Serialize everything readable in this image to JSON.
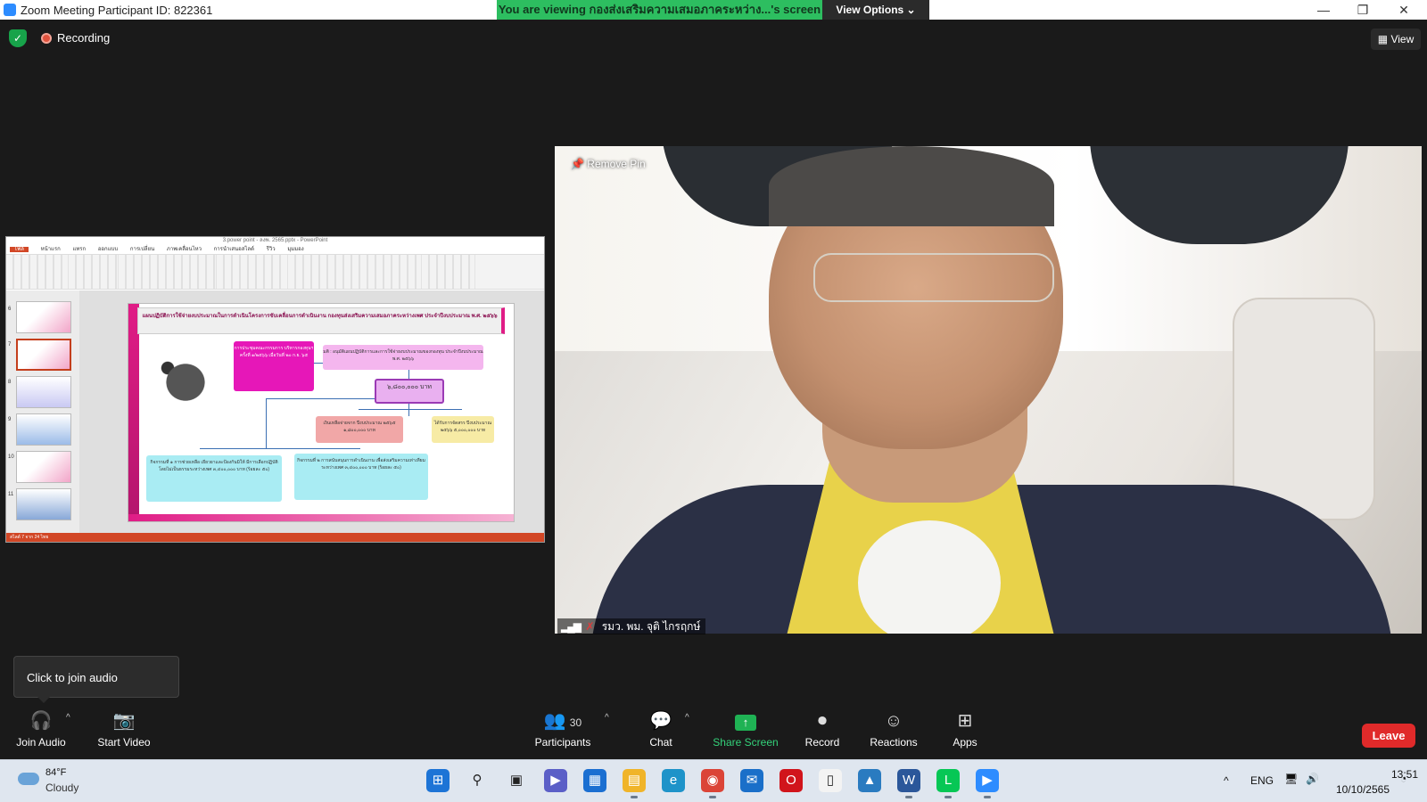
{
  "window": {
    "title": "Zoom Meeting Participant ID: 822361",
    "minimize": "—",
    "restore": "❐",
    "close": "✕"
  },
  "share_banner": {
    "text": "You are viewing กองส่งเสริมความเสมอภาคระหว่าง...'s screen",
    "view_options": "View Options ⌄",
    "bg_color": "#2dbe60"
  },
  "meeting_status": {
    "shield_icon": "✓",
    "recording_label": "Recording",
    "view_button": "▦ View"
  },
  "video": {
    "remove_pin": "Remove Pin",
    "participant_name": "รมว. พม. จุติ ไกรฤกษ์"
  },
  "shared_screen": {
    "window_title": "3.power point - ลงพ. 2565.pptx - PowerPoint",
    "ribbon_tabs": [
      "ไฟล์",
      "หน้าแรก",
      "แทรก",
      "ออกแบบ",
      "การเปลี่ยน",
      "ภาพเคลื่อนไหว",
      "การนำเสนอสไลด์",
      "รีวิว",
      "มุมมอง"
    ],
    "thumb_numbers": [
      "6",
      "7",
      "8",
      "9",
      "10",
      "11"
    ],
    "slide_title": "แผนปฏิบัติการใช้จ่ายงบประมาณในการดำเนินโครงการขับเคลื่อนการดำเนินงาน กองทุนส่งเสริมความเสมอภาคระหว่างเพศ ประจำปีงบประมาณ พ.ศ. ๒๕๖๖",
    "box_meeting": "การประชุมคณะกรรมการ บริหารกองทุนฯ ครั้งที่ ๑/๒๕๖๖ เมื่อวันที่ ๒๐ ก.ย. ๖๕",
    "box_resolution": "มติ : อนุมัติแผนปฏิบัติการและการใช้จ่ายงบประมาณของกองทุน ประจำปีงบประมาณ พ.ศ. ๒๕๖๖",
    "box_total": "๖,๘๐๐,๐๐๐ บาท",
    "box_carry": "เงินเหลือจ่ายจาก ปีงบประมาณ ๒๕๖๕ ๑,๘๐๐,๐๐๐ บาท",
    "box_alloc": "ได้รับการจัดสรร ปีงบประมาณ ๒๕๖๖ ๕,๐๐๐,๐๐๐ บาท",
    "box_act1": "กิจกรรมที่ ๑ การช่วยเหลือ เยียวยาและป้องกันมิให้ มีการเลือกปฏิบัติโดยไม่เป็นธรรมระหว่างเพศ ๓,๔๐๐,๐๐๐ บาท (ร้อยละ ๕๐)",
    "box_act2": "กิจกรรมที่ ๒ การสนับสนุนการดำเนินงาน เพื่อส่งเสริมความเท่าเทียมระหว่างเพศ ๓,๔๐๐,๐๐๐ บาท (ร้อยละ ๕๐)",
    "status_text": "สไลด์ 7 จาก 24    ไทย"
  },
  "tooltip": {
    "text": "Click to join audio"
  },
  "toolbar": {
    "join_audio": {
      "label": "Join Audio",
      "icon": "🎧"
    },
    "start_video": {
      "label": "Start Video",
      "icon": "📷"
    },
    "participants": {
      "label": "Participants",
      "count": "30",
      "icon": "👥"
    },
    "chat": {
      "label": "Chat",
      "icon": "💬"
    },
    "share_screen": {
      "label": "Share Screen",
      "icon": "↑",
      "color": "#34d27a"
    },
    "record": {
      "label": "Record",
      "icon": "⏺"
    },
    "reactions": {
      "label": "Reactions",
      "icon": "☺"
    },
    "apps": {
      "label": "Apps",
      "icon": "⊞"
    },
    "leave": {
      "label": "Leave",
      "color": "#e02a2a"
    },
    "caret": "^"
  },
  "taskbar": {
    "weather_temp": "84°F",
    "weather_desc": "Cloudy",
    "apps": [
      {
        "name": "start",
        "glyph": "⊞",
        "color": "#1d74d6"
      },
      {
        "name": "search",
        "glyph": "⚲",
        "color": "#dfe6ef"
      },
      {
        "name": "task-view",
        "glyph": "▣",
        "color": "#dfe6ef"
      },
      {
        "name": "teams",
        "glyph": "▶",
        "color": "#5b5fc7"
      },
      {
        "name": "store",
        "glyph": "▦",
        "color": "#1b6fd1"
      },
      {
        "name": "file-explorer",
        "glyph": "▤",
        "color": "#f0b429"
      },
      {
        "name": "edge",
        "glyph": "e",
        "color": "#1e93c9"
      },
      {
        "name": "chrome",
        "glyph": "◉",
        "color": "#db4437"
      },
      {
        "name": "mail",
        "glyph": "✉",
        "color": "#1a6fc9"
      },
      {
        "name": "opera",
        "glyph": "O",
        "color": "#d1141b"
      },
      {
        "name": "notepad",
        "glyph": "▯",
        "color": "#f3f3f3"
      },
      {
        "name": "photos",
        "glyph": "▲",
        "color": "#2a7bc0"
      },
      {
        "name": "word",
        "glyph": "W",
        "color": "#2b579a"
      },
      {
        "name": "line",
        "glyph": "L",
        "color": "#06c755"
      },
      {
        "name": "zoom",
        "glyph": "▶",
        "color": "#2d8cff"
      }
    ],
    "tray_chevron": "^",
    "language": "ENG",
    "network_icon": "🖥",
    "volume_icon": "🔊",
    "time": "13:51",
    "date": "10/10/2565",
    "notification_icon": "◔"
  }
}
